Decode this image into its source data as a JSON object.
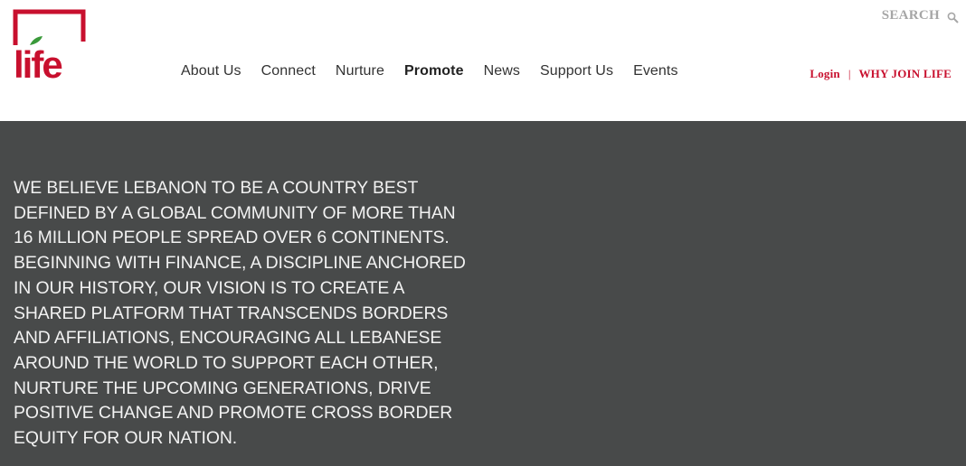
{
  "brand": {
    "logo_text": "life",
    "accent_color": "#c8102e",
    "leaf_color": "#3a9a3a"
  },
  "nav": {
    "items": [
      {
        "label": "About Us"
      },
      {
        "label": "Connect"
      },
      {
        "label": "Nurture"
      },
      {
        "label": "Promote",
        "active": true
      },
      {
        "label": "News"
      },
      {
        "label": "Support Us"
      },
      {
        "label": "Events"
      }
    ]
  },
  "search": {
    "label": "SEARCH",
    "icon": "search-icon"
  },
  "account": {
    "login_label": "Login",
    "separator": "|",
    "join_label": "WHY JOIN LIFE"
  },
  "hero": {
    "background_color": "#484a4a",
    "text": "WE BELIEVE LEBANON TO BE A COUNTRY BEST DEFINED BY A GLOBAL COMMUNITY OF MORE THAN 16 MILLION PEOPLE SPREAD OVER 6 CONTINENTS. BEGINNING WITH FINANCE, A DISCIPLINE ANCHORED IN OUR HISTORY, OUR VISION IS TO CREATE A SHARED PLATFORM THAT TRANSCENDS BORDERS AND AFFILIATIONS, ENCOURAGING ALL LEBANESE AROUND THE WORLD TO SUPPORT EACH OTHER, NURTURE THE UPCOMING GENERATIONS, DRIVE POSITIVE CHANGE AND PROMOTE CROSS BORDER EQUITY FOR OUR NATION."
  }
}
